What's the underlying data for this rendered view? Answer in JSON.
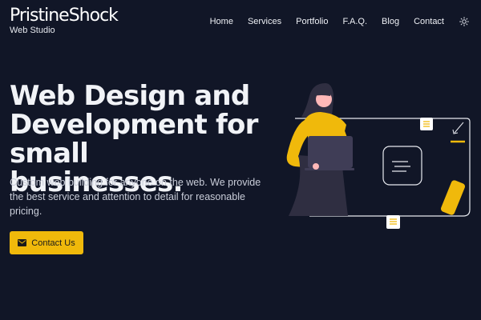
{
  "header": {
    "brand": "PristineShock",
    "tagline": "Web Studio",
    "nav": [
      "Home",
      "Services",
      "Portfolio",
      "F.A.Q.",
      "Blog",
      "Contact"
    ],
    "theme_icon": "sun-icon"
  },
  "hero": {
    "title_lines": [
      "Web Design and",
      "Development for",
      "small businesses."
    ],
    "subtitle": "Custom web building for anyone on the web. We provide the best service and attention to detail for reasonable pricing.",
    "cta_label": "Contact Us",
    "cta_icon": "mail-icon"
  },
  "colors": {
    "background": "#111627",
    "accent": "#f0b90b",
    "text": "#ffffff"
  }
}
